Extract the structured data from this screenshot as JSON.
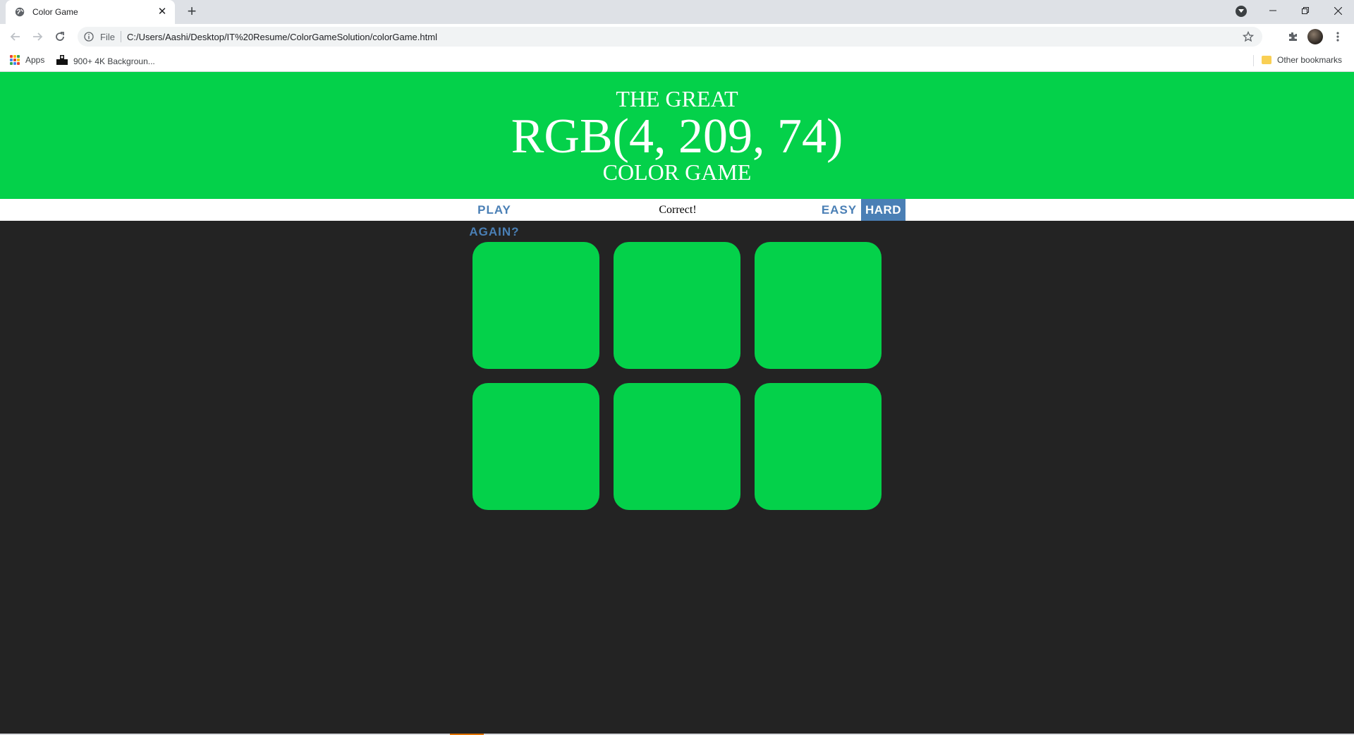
{
  "browser": {
    "tab_title": "Color Game",
    "newtab_symbol": "+",
    "close_symbol": "✕",
    "address_scheme": "File",
    "address_url": "C:/Users/Aashi/Desktop/IT%20Resume/ColorGameSolution/colorGame.html",
    "bookmarks": {
      "apps_label": "Apps",
      "item1_label": "900+ 4K Backgroun...",
      "other_label": "Other bookmarks"
    }
  },
  "game": {
    "header_line1": "THE GREAT",
    "rgb_display": "RGB(4, 209, 74)",
    "header_line3": "COLOR GAME",
    "reset_label": "PLAY AGAIN?",
    "message": "Correct!",
    "easy_label": "EASY",
    "hard_label": "HARD",
    "selected_mode": "HARD",
    "square_color": "#04d14a",
    "square_count": 6,
    "accent_color": "#4a7fb5",
    "background_color": "#232323"
  }
}
